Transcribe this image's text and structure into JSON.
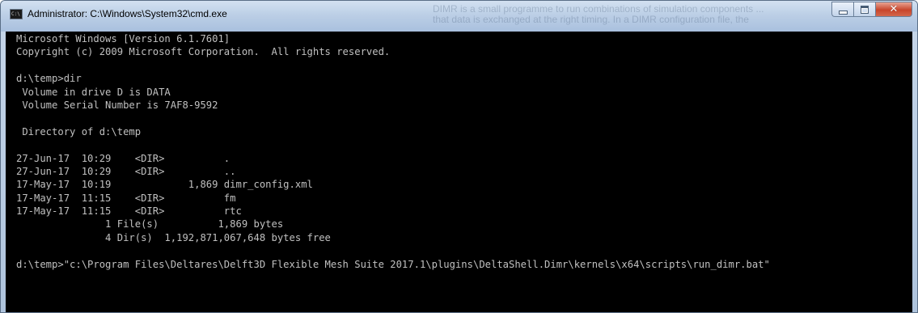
{
  "window": {
    "title": "Administrator: C:\\Windows\\System32\\cmd.exe",
    "icon": "cmd-icon",
    "icon_label": "C:\\"
  },
  "caption_buttons": {
    "minimize_icon": "minimize-icon",
    "maximize_icon": "maximize-icon",
    "close_icon": "close-icon",
    "close_glyph": "✕"
  },
  "background_text": "DIMR is a small programme to run combinations of simulation components ... that data is exchanged at the right timing. In a DIMR configuration file, the",
  "console": {
    "lines": [
      "Microsoft Windows [Version 6.1.7601]",
      "Copyright (c) 2009 Microsoft Corporation.  All rights reserved.",
      "",
      "d:\\temp>dir",
      " Volume in drive D is DATA",
      " Volume Serial Number is 7AF8-9592",
      "",
      " Directory of d:\\temp",
      "",
      "27-Jun-17  10:29    <DIR>          .",
      "27-Jun-17  10:29    <DIR>          ..",
      "17-May-17  10:19             1,869 dimr_config.xml",
      "17-May-17  11:15    <DIR>          fm",
      "17-May-17  11:15    <DIR>          rtc",
      "               1 File(s)          1,869 bytes",
      "               4 Dir(s)  1,192,871,067,648 bytes free",
      "",
      "d:\\temp>\"c:\\Program Files\\Deltares\\Delft3D Flexible Mesh Suite 2017.1\\plugins\\DeltaShell.Dimr\\kernels\\x64\\scripts\\run_dimr.bat\"",
      "",
      ""
    ]
  },
  "colors": {
    "console_bg": "#000000",
    "console_fg": "#c0c0c0",
    "close_button": "#c8452b",
    "titlebar": "#bccfe6"
  }
}
